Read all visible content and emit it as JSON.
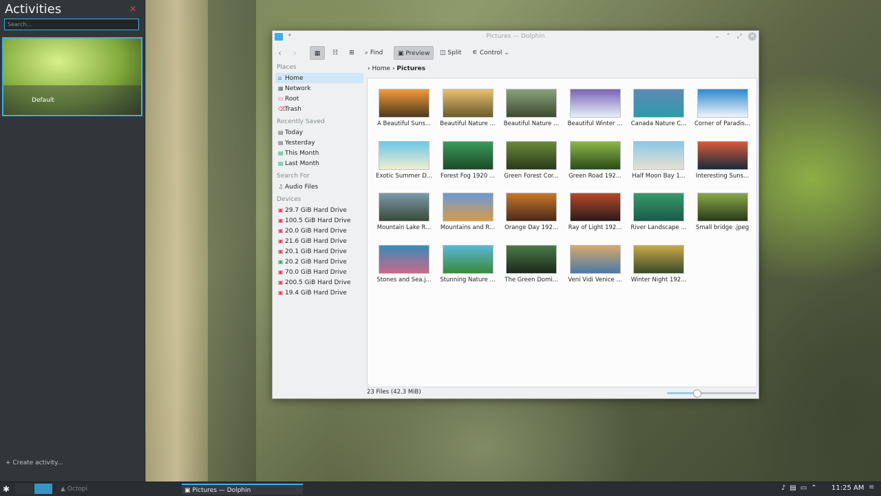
{
  "activities": {
    "title": "Activities",
    "search_placeholder": "Search...",
    "card_name": "Default",
    "create_label": "+ Create activity..."
  },
  "taskbar": {
    "task_inactive": "Octopi",
    "task_active": "Pictures — Dolphin",
    "clock": "11:25 AM"
  },
  "dolphin": {
    "window_title": "Pictures — Dolphin",
    "toolbar": {
      "find": "Find",
      "preview": "Preview",
      "split": "Split",
      "control": "Control"
    },
    "breadcrumb": {
      "home": "Home",
      "current": "Pictures"
    },
    "places": {
      "places_header": "Places",
      "places": [
        {
          "label": "Home",
          "icon": "home-icon"
        },
        {
          "label": "Network",
          "icon": "network-icon"
        },
        {
          "label": "Root",
          "icon": "folder-red-icon"
        },
        {
          "label": "Trash",
          "icon": "trash-icon"
        }
      ],
      "recent_header": "Recently Saved",
      "recent": [
        {
          "label": "Today"
        },
        {
          "label": "Yesterday"
        },
        {
          "label": "This Month"
        },
        {
          "label": "Last Month"
        }
      ],
      "search_header": "Search For",
      "search": [
        {
          "label": "Audio Files"
        }
      ],
      "devices_header": "Devices",
      "devices": [
        {
          "label": "29.7 GiB Hard Drive"
        },
        {
          "label": "100.5 GiB Hard Drive"
        },
        {
          "label": "20.0 GiB Hard Drive"
        },
        {
          "label": "21.6 GiB Hard Drive"
        },
        {
          "label": "20.1 GiB Hard Drive"
        },
        {
          "label": "20.2 GiB Hard Drive"
        },
        {
          "label": "70.0 GiB Hard Drive"
        },
        {
          "label": "200.5 GiB Hard Drive"
        },
        {
          "label": "19.4 GiB Hard Drive"
        }
      ]
    },
    "files": [
      {
        "name": "A Beautiful Suns...",
        "colors": [
          "#f29a3a",
          "#4e3a1e"
        ]
      },
      {
        "name": "Beautiful Nature ...",
        "colors": [
          "#e8c070",
          "#6a5a2a"
        ]
      },
      {
        "name": "Beautiful Nature ...",
        "colors": [
          "#8aa27a",
          "#3d4a33"
        ]
      },
      {
        "name": "Beautiful Winter ...",
        "colors": [
          "#7a64b8",
          "#e8eef6"
        ]
      },
      {
        "name": "Canada Nature C...",
        "colors": [
          "#5e8ab8",
          "#2e9aa8"
        ]
      },
      {
        "name": "Corner of Paradis...",
        "colors": [
          "#2d8ad0",
          "#f0f4f8"
        ]
      },
      {
        "name": "Exotic Summer D...",
        "colors": [
          "#6cc8e8",
          "#f0ecd0"
        ]
      },
      {
        "name": "Forest Fog 1920 ...",
        "colors": [
          "#3a9a5a",
          "#1d4a2a"
        ]
      },
      {
        "name": "Green Forest Cor...",
        "colors": [
          "#6a8a3a",
          "#2a3a1a"
        ]
      },
      {
        "name": "Green Road 192...",
        "colors": [
          "#8ab84a",
          "#2d4a1a"
        ]
      },
      {
        "name": "Half Moon Bay 1...",
        "colors": [
          "#8ac8e8",
          "#e8e0d0"
        ]
      },
      {
        "name": "Interesting Suns...",
        "colors": [
          "#d85a3a",
          "#1a2a3a"
        ]
      },
      {
        "name": "Mountain Lake R...",
        "colors": [
          "#7a9aa8",
          "#3a4a3a"
        ]
      },
      {
        "name": "Mountains and R...",
        "colors": [
          "#6a9ad8",
          "#d89a4a"
        ]
      },
      {
        "name": "Orange Day 192...",
        "colors": [
          "#c8782a",
          "#4a2a1a"
        ]
      },
      {
        "name": "Ray of Light 192...",
        "colors": [
          "#b84a2a",
          "#2a1a1a"
        ]
      },
      {
        "name": "River Landscape ...",
        "colors": [
          "#3a9a6a",
          "#1a5a4a"
        ]
      },
      {
        "name": "Small bridge .jpeg",
        "colors": [
          "#8aa84a",
          "#2a3a1a"
        ]
      },
      {
        "name": "Stones and Sea.j...",
        "colors": [
          "#3a8ab8",
          "#c86a8a"
        ]
      },
      {
        "name": "Stunning Nature ...",
        "colors": [
          "#5ab8d8",
          "#3a8a3a"
        ]
      },
      {
        "name": "The Green Domi...",
        "colors": [
          "#4a7a4a",
          "#1a2a1a"
        ]
      },
      {
        "name": "Veni Vidi Venice ...",
        "colors": [
          "#d8a86a",
          "#4a7aa8"
        ]
      },
      {
        "name": "Winter Night 192...",
        "colors": [
          "#c8a84a",
          "#3a4a2a"
        ]
      }
    ],
    "status": "23 Files (42.3 MiB)",
    "zoom_level": 0.33
  }
}
